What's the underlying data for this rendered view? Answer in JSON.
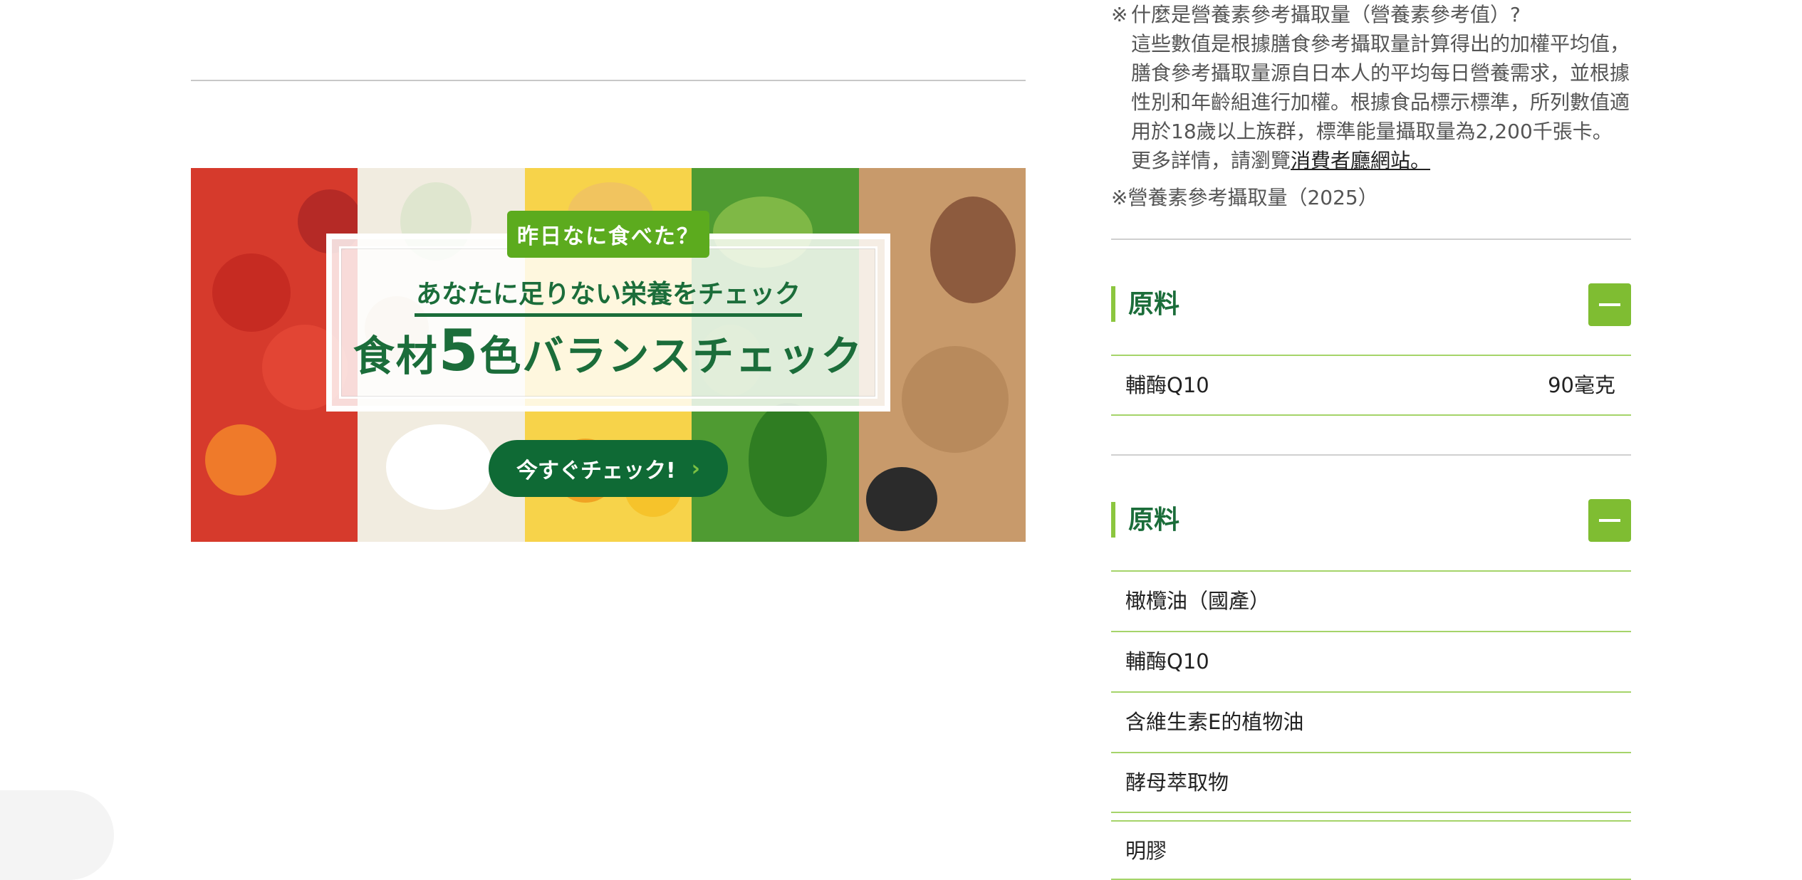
{
  "nutrition_note": {
    "mark": "※",
    "question": "什麼是營養素參考攝取量（營養素參考值）?",
    "body": "這些數值是根據膳食參考攝取量計算得出的加權平均值，膳食參考攝取量源自日本人的平均每日營養需求，並根據性別和年齡組進行加權。根據食品標示標準，所列數值適用於18歲以上族群，標準能量攝取量為2,200千張卡。更多詳情，請瀏覽",
    "link": "消費者廳網站。",
    "source": "※營養素參考攝取量（2025）"
  },
  "banner": {
    "tag": "昨日なに食べた？",
    "subtitle": "あなたに足りない栄養をチェック",
    "title_prefix": "食材",
    "title_number": "5",
    "title_suffix": "色バランスチェック",
    "button_label": "今すぐチェック!",
    "button_icon": "chevron-right-icon"
  },
  "sections": [
    {
      "title": "原料",
      "toggle_icon": "minus-icon",
      "rows": [
        {
          "name": "輔酶Q10",
          "amount": "90毫克"
        }
      ]
    },
    {
      "title": "原料",
      "toggle_icon": "minus-icon",
      "rows": [
        {
          "name": "橄欖油（國產）"
        },
        {
          "name": "輔酶Q10"
        },
        {
          "name": "含維生素E的植物油"
        },
        {
          "name": "酵母萃取物"
        },
        {
          "name": "明膠"
        }
      ]
    }
  ],
  "colors": {
    "brand_green": "#1b6d3a",
    "accent_green": "#7fbd32",
    "row_line": "#a5d46a"
  }
}
